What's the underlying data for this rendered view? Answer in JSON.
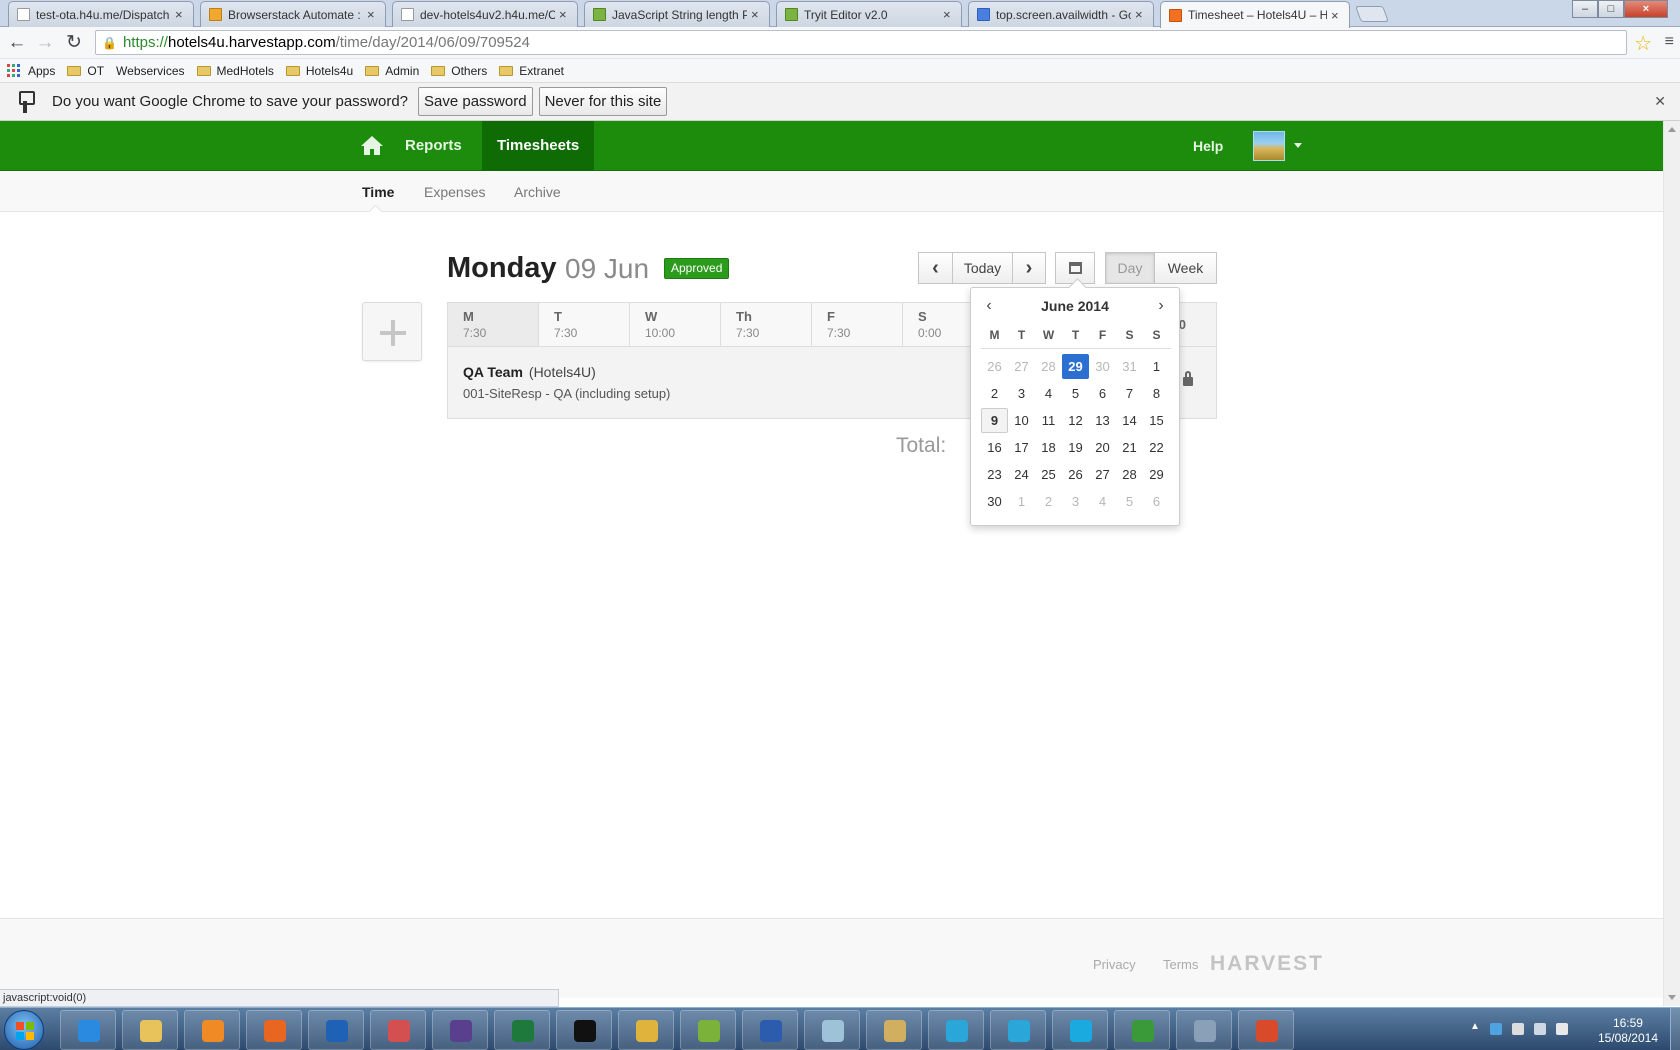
{
  "browser": {
    "tabs": [
      {
        "title": "test-ota.h4u.me/Dispatch",
        "fav_color": "#ffffff"
      },
      {
        "title": "Browserstack Automate : ",
        "fav_color": "#f0a830"
      },
      {
        "title": "dev-hotels4uv2.h4u.me/C",
        "fav_color": "#ffffff"
      },
      {
        "title": "JavaScript String length Pr",
        "fav_color": "#7cb342"
      },
      {
        "title": "Tryit Editor v2.0",
        "fav_color": "#7cb342"
      },
      {
        "title": "top.screen.availwidth - Go",
        "fav_color": "#4a7fe0"
      },
      {
        "title": "Timesheet – Hotels4U – H",
        "fav_color": "#f37021"
      }
    ],
    "url_scheme": "https://",
    "url_host": "hotels4u.harvestapp.com",
    "url_path": "/time/day/2014/06/09/709524",
    "bookmarks": [
      "Apps",
      "OT",
      "Webservices",
      "MedHotels",
      "Hotels4u",
      "Admin",
      "Others",
      "Extranet"
    ],
    "password_prompt": "Do you want Google Chrome to save your password?",
    "save_password_label": "Save password",
    "never_label": "Never for this site",
    "status_text": "javascript:void(0)"
  },
  "harvest": {
    "nav": {
      "reports": "Reports",
      "timesheets": "Timesheets",
      "help": "Help"
    },
    "subnav": {
      "time": "Time",
      "expenses": "Expenses",
      "archive": "Archive"
    },
    "day": {
      "weekday": "Monday",
      "date": "09 Jun",
      "status": "Approved"
    },
    "controls": {
      "today": "Today",
      "day": "Day",
      "week": "Week",
      "prev_glyph": "‹",
      "next_glyph": "›"
    },
    "week": [
      {
        "name": "M",
        "hours": "7:30"
      },
      {
        "name": "T",
        "hours": "7:30"
      },
      {
        "name": "W",
        "hours": "10:00"
      },
      {
        "name": "Th",
        "hours": "7:30"
      },
      {
        "name": "F",
        "hours": "7:30"
      },
      {
        "name": "S",
        "hours": "0:00"
      }
    ],
    "week_total_partial": "0",
    "entry": {
      "project": "QA Team",
      "client": "(Hotels4U)",
      "task": "001-SiteResp - QA (including setup)"
    },
    "total_label": "Total:",
    "footer": {
      "privacy": "Privacy",
      "terms": "Terms",
      "brand": "HARVEST"
    }
  },
  "datepicker": {
    "month_label": "June 2014",
    "prev_glyph": "‹",
    "next_glyph": "›",
    "dow": [
      "M",
      "T",
      "W",
      "T",
      "F",
      "S",
      "S"
    ],
    "weeks": [
      [
        "26",
        "27",
        "28",
        "29",
        "30",
        "31",
        "1"
      ],
      [
        "2",
        "3",
        "4",
        "5",
        "6",
        "7",
        "8"
      ],
      [
        "9",
        "10",
        "11",
        "12",
        "13",
        "14",
        "15"
      ],
      [
        "16",
        "17",
        "18",
        "19",
        "20",
        "21",
        "22"
      ],
      [
        "23",
        "24",
        "25",
        "26",
        "27",
        "28",
        "29"
      ],
      [
        "30",
        "1",
        "2",
        "3",
        "4",
        "5",
        "6"
      ]
    ],
    "muted": [
      [
        0,
        0
      ],
      [
        0,
        1
      ],
      [
        0,
        2
      ],
      [
        0,
        4
      ],
      [
        0,
        5
      ],
      [
        5,
        1
      ],
      [
        5,
        2
      ],
      [
        5,
        3
      ],
      [
        5,
        4
      ],
      [
        5,
        5
      ],
      [
        5,
        6
      ]
    ],
    "selected": [
      0,
      3
    ],
    "today": [
      2,
      0
    ]
  },
  "taskbar": {
    "apps": [
      {
        "name": "internet-explorer",
        "color": "#2a8ae0"
      },
      {
        "name": "file-explorer",
        "color": "#e8c25a"
      },
      {
        "name": "media-player",
        "color": "#f08a24"
      },
      {
        "name": "firefox",
        "color": "#e8661f"
      },
      {
        "name": "outlook",
        "color": "#1f62b5"
      },
      {
        "name": "snipping-tool",
        "color": "#d45050"
      },
      {
        "name": "eclipse",
        "color": "#5b3f8f"
      },
      {
        "name": "excel",
        "color": "#1e7a3c"
      },
      {
        "name": "command-prompt",
        "color": "#111111"
      },
      {
        "name": "chrome",
        "color": "#e0b43c"
      },
      {
        "name": "notepad-plus",
        "color": "#7bb33a"
      },
      {
        "name": "word",
        "color": "#2b5cad"
      },
      {
        "name": "notes",
        "color": "#9ec3d9"
      },
      {
        "name": "tools",
        "color": "#d0b060"
      },
      {
        "name": "webstorm",
        "color": "#2aa7d8"
      },
      {
        "name": "webstorm-2",
        "color": "#2aa7d8"
      },
      {
        "name": "skype",
        "color": "#1aaae0"
      },
      {
        "name": "sync",
        "color": "#3a9a3a"
      },
      {
        "name": "calculator",
        "color": "#8aa0b8"
      },
      {
        "name": "headphones",
        "color": "#d84a2a"
      }
    ],
    "time": "16:59",
    "date": "15/08/2014"
  }
}
